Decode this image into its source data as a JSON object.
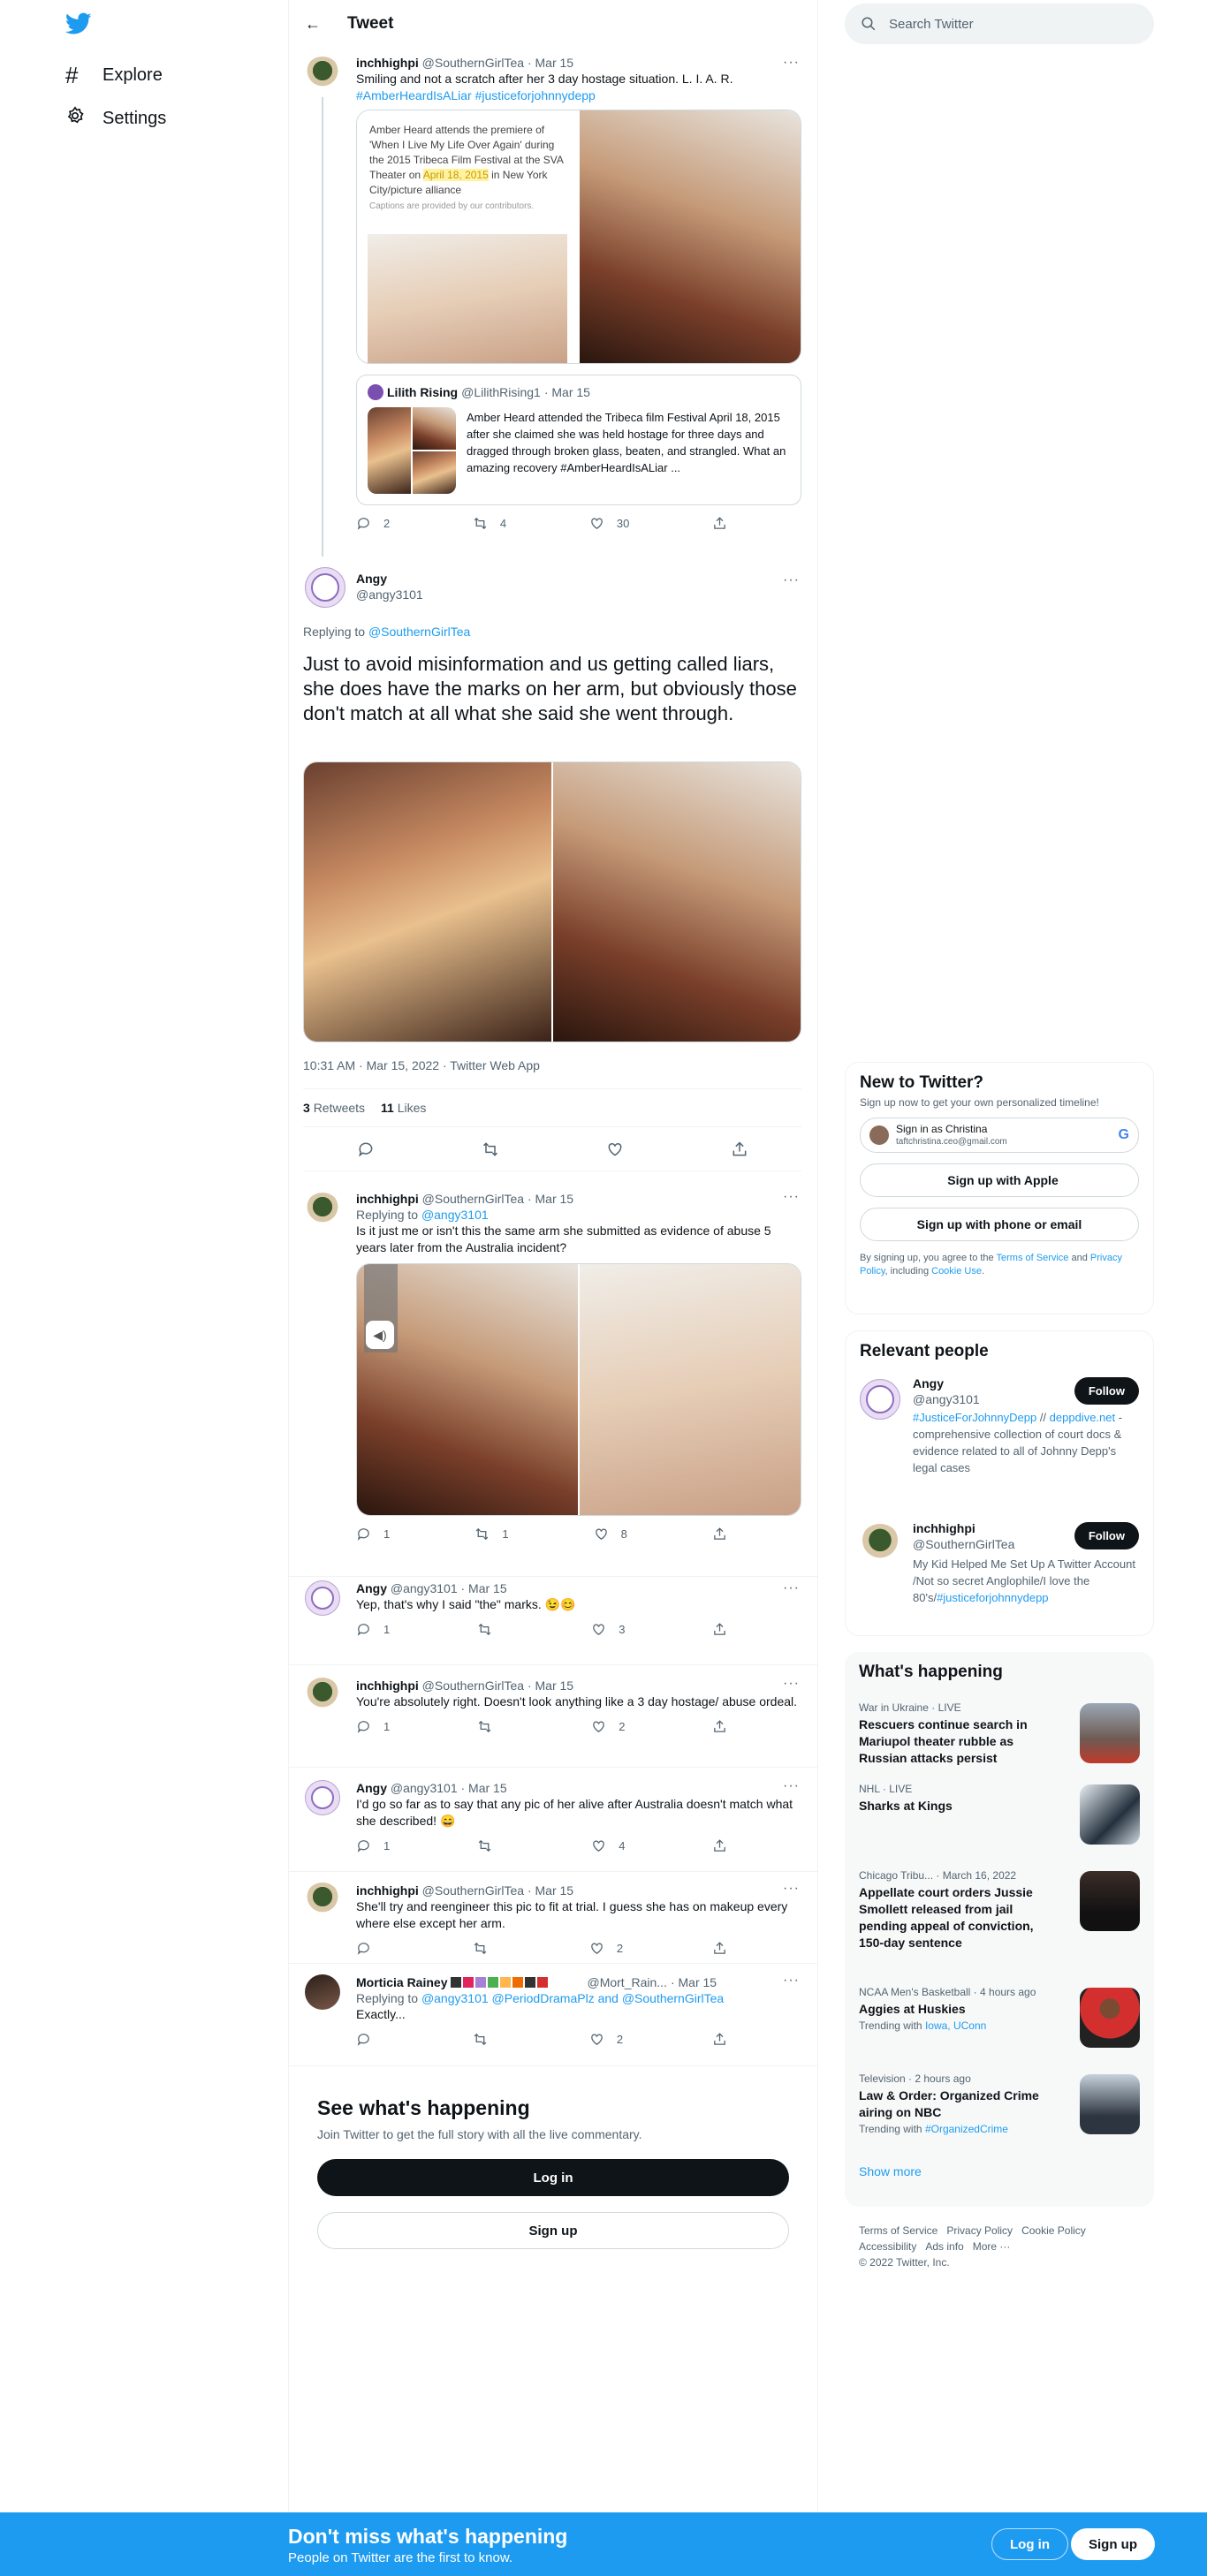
{
  "nav": {
    "explore": "Explore",
    "settings": "Settings"
  },
  "header": {
    "title": "Tweet"
  },
  "search": {
    "placeholder": "Search Twitter"
  },
  "quoted_parent": {
    "name": "inchhighpi",
    "handle": "@SouthernGirlTea",
    "date": "· Mar 15",
    "text": "Smiling and not a scratch after her 3 day hostage situation.  L. I. A. R.",
    "hashtags": "#AmberHeardIsALiar #justiceforjohnnydepp",
    "caption_pre": "Amber Heard attends the premiere of 'When I Live My Life Over Again' during the 2015 Tribeca Film Festival at the SVA Theater on ",
    "caption_date": "April 18, 2015",
    "caption_post": " in New York City/picture alliance",
    "caption_note": "Captions are provided by our contributors.",
    "quote": {
      "name": "Lilith Rising",
      "handle": "@LilithRising1",
      "date": "· Mar 15",
      "text": "Amber Heard attended the Tribeca film Festival April 18, 2015 after she claimed she was held hostage for three days and dragged through broken glass, beaten, and strangled. What an amazing recovery #AmberHeardIsALiar ..."
    },
    "replies": "2",
    "retweets": "4",
    "likes": "30"
  },
  "main_tweet": {
    "name": "Angy",
    "handle": "@angy3101",
    "replying_label": "Replying to ",
    "replying_to": "@SouthernGirlTea",
    "text": "Just to avoid misinformation and us getting called liars, she does have the marks on her arm, but obviously those don't match at all what she said she went through.",
    "timestamp": "10:31 AM · Mar 15, 2022 · Twitter Web App",
    "retweets_count": "3",
    "retweets_label": "Retweets",
    "likes_count": "11",
    "likes_label": "Likes"
  },
  "replies": [
    {
      "name": "inchhighpi",
      "handle": "@SouthernGirlTea",
      "date": "· Mar 15",
      "replying_label": "Replying to ",
      "replying_to": "@angy3101",
      "text": "Is it just me or isn't this the same arm she submitted as evidence of abuse 5 years later from the Australia incident?",
      "replies": "1",
      "retweets": "1",
      "likes": "8"
    },
    {
      "name": "Angy",
      "handle": "@angy3101",
      "date": "· Mar 15",
      "text": "Yep, that's why I said \"the\" marks. 😉😊",
      "replies": "1",
      "retweets": "",
      "likes": "3"
    },
    {
      "name": "inchhighpi",
      "handle": "@SouthernGirlTea",
      "date": "· Mar 15",
      "text": "You're absolutely right.  Doesn't look anything like a 3 day hostage/ abuse ordeal.",
      "replies": "1",
      "retweets": "",
      "likes": "2"
    },
    {
      "name": "Angy",
      "handle": "@angy3101",
      "date": "· Mar 15",
      "text": "I'd go so far as to say that any pic of her alive after Australia doesn't match what she described! 😄",
      "replies": "1",
      "retweets": "",
      "likes": "4"
    },
    {
      "name": "inchhighpi",
      "handle": "@SouthernGirlTea",
      "date": "· Mar 15",
      "text": "She'll try and reengineer this pic to fit at trial.  I guess she has on makeup every where else except her arm.",
      "replies": "",
      "retweets": "",
      "likes": "2"
    },
    {
      "name": "Morticia Rainey",
      "handle": "@Mort_Rain...",
      "date": "· Mar 15",
      "replying_label": "Replying to ",
      "replying_to": "@angy3101 @PeriodDramaPlz and @SouthernGirlTea",
      "text": "Exactly...",
      "replies": "",
      "retweets": "",
      "likes": "2"
    }
  ],
  "see_whats_happening": {
    "title": "See what's happening",
    "subtitle": "Join Twitter to get the full story with all the live commentary.",
    "login": "Log in",
    "signup": "Sign up"
  },
  "new_to_twitter": {
    "title": "New to Twitter?",
    "subtitle": "Sign up now to get your own personalized timeline!",
    "signin_as": "Sign in as Christina",
    "signin_email": "taftchristina.ceo@gmail.com",
    "apple": "Sign up with Apple",
    "phone": "Sign up with phone or email",
    "legal_pre": "By signing up, you agree to the ",
    "terms": "Terms of Service",
    "and": " and ",
    "privacy": "Privacy Policy",
    "including": ", including ",
    "cookie": "Cookie Use",
    "end": "."
  },
  "relevant_people": {
    "title": "Relevant people",
    "people": [
      {
        "name": "Angy",
        "handle": "@angy3101",
        "follow": "Follow",
        "bio_link": "#JusticeForJohnnyDepp",
        "bio_mid": " // ",
        "bio_link2": "deppdive.net",
        "bio": " - comprehensive collection of court docs & evidence related to all of Johnny Depp's legal cases"
      },
      {
        "name": "inchhighpi",
        "handle": "@SouthernGirlTea",
        "follow": "Follow",
        "bio": "My Kid Helped Me Set Up A Twitter Account /Not so secret Anglophile/I love the 80's/",
        "bio_link": "#justiceforjohnnydepp"
      }
    ]
  },
  "whats_happening": {
    "title": "What's happening",
    "trends": [
      {
        "meta": "War in Ukraine · LIVE",
        "title": "Rescuers continue search in Mariupol theater rubble as Russian attacks persist"
      },
      {
        "meta": "NHL · LIVE",
        "title": "Sharks at Kings"
      },
      {
        "meta": "Chicago Tribu... · March 16, 2022",
        "title": "Appellate court orders Jussie Smollett released from jail pending appeal of conviction, 150-day sentence"
      },
      {
        "meta": "NCAA Men's Basketball · 4 hours ago",
        "title": "Aggies at Huskies",
        "trending_label": "Trending with ",
        "trending": "Iowa, UConn"
      },
      {
        "meta": "Television · 2 hours ago",
        "title": "Law & Order: Organized Crime airing on NBC",
        "trending_label": "Trending with ",
        "trending": "#OrganizedCrime"
      }
    ],
    "show_more": "Show more"
  },
  "footer": {
    "terms": "Terms of Service",
    "privacy": "Privacy Policy",
    "cookie": "Cookie Policy",
    "accessibility": "Accessibility",
    "ads": "Ads info",
    "more": "More ···",
    "copyright": "© 2022 Twitter, Inc."
  },
  "bottom_bar": {
    "title": "Don't miss what's happening",
    "subtitle": "People on Twitter are the first to know.",
    "login": "Log in",
    "signup": "Sign up"
  }
}
